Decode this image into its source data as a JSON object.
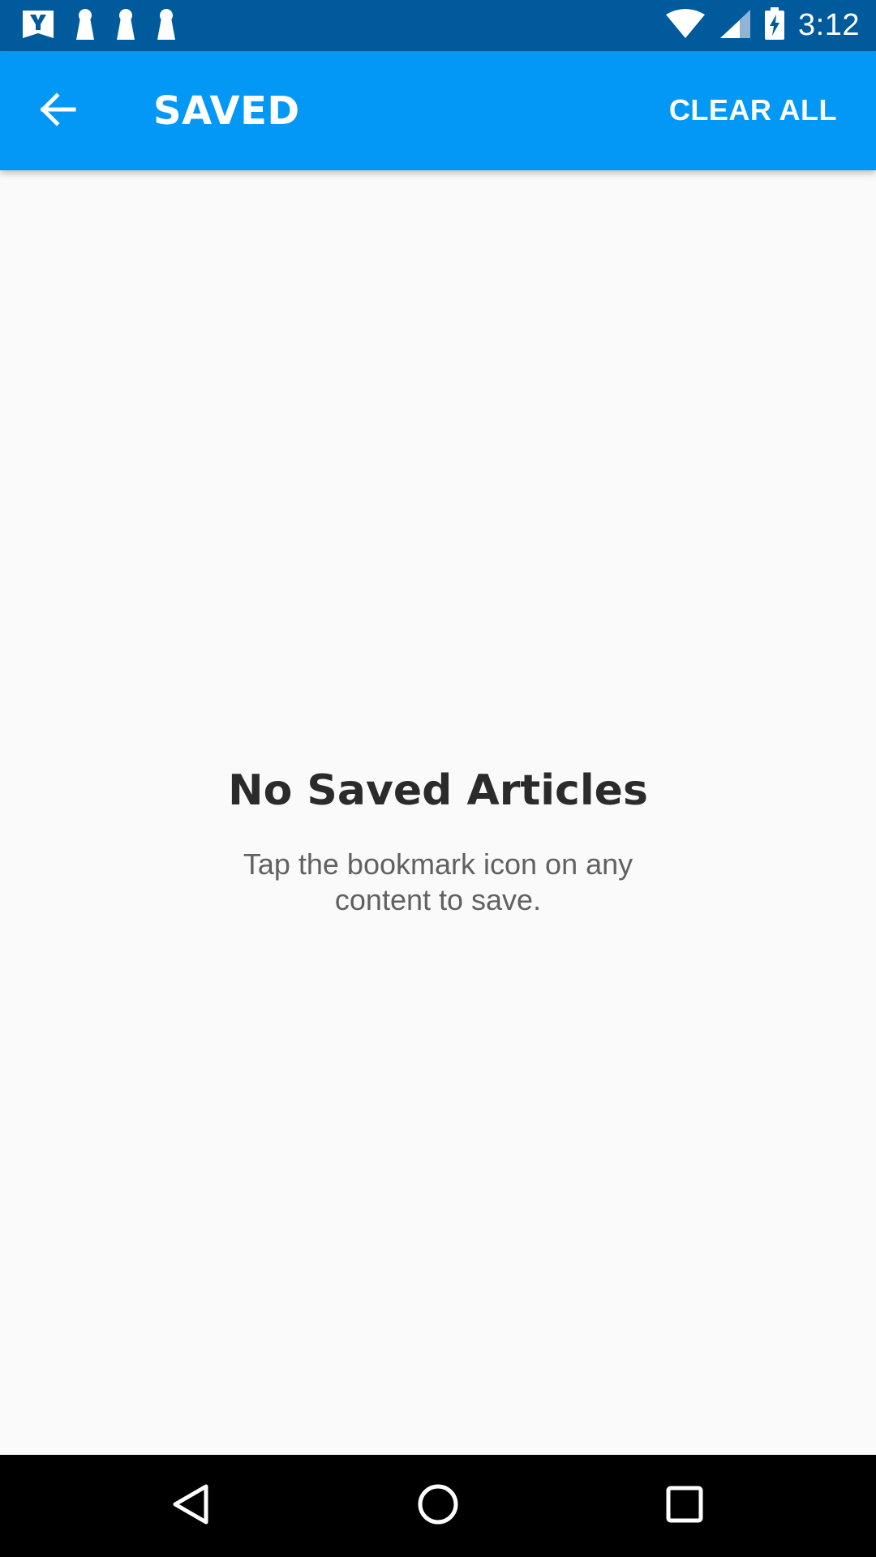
{
  "status_bar": {
    "time": "3:12",
    "notification_icons": [
      "yahoo-icon",
      "keyhole-icon",
      "keyhole-icon",
      "keyhole-icon"
    ],
    "system_icons": [
      "wifi-icon",
      "cell-signal-icon",
      "battery-charging-icon"
    ],
    "background_color": "#005a9b"
  },
  "app_bar": {
    "title": "SAVED",
    "action_label": "CLEAR ALL",
    "background_color": "#0398f6"
  },
  "empty_state": {
    "title": "No Saved Articles",
    "message": "Tap the bookmark icon on any content to save."
  },
  "nav_bar": {
    "buttons": [
      "back-triangle-icon",
      "home-circle-icon",
      "recents-square-icon"
    ]
  }
}
